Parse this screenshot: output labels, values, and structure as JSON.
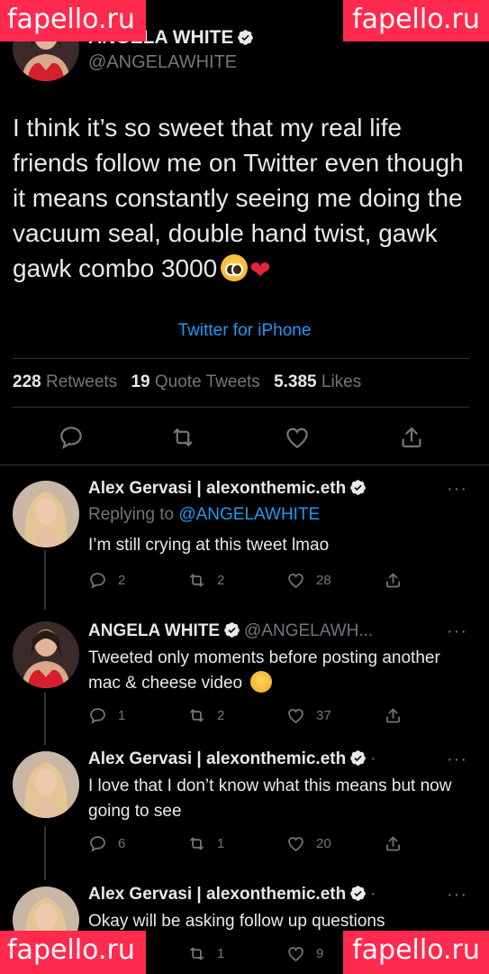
{
  "watermark": "fapello.ru",
  "main_tweet": {
    "name": "ANGELA WHITE",
    "name_visible": "ANGELA WHITE",
    "handle": "@ANGELAWHITE",
    "text": "I think it’s so sweet that my real life friends follow me on Twitter even though it means constantly seeing me doing the vacuum seal, double hand twist, gawk gawk combo 3000",
    "emojis": [
      "pleading-face-emoji",
      "red-heart-emoji"
    ],
    "source": "Twitter for iPhone",
    "stats": {
      "retweets_count": "228",
      "retweets_label": "Retweets",
      "quotes_count": "19",
      "quotes_label": "Quote Tweets",
      "likes_count": "5.385",
      "likes_label": "Likes"
    }
  },
  "replies": [
    {
      "name": "Alex Gervasi | alexonthemic.eth",
      "handle": "",
      "replying_prefix": "Replying to ",
      "replying_to": "@ANGELAWHITE",
      "text": "I’m still crying at this tweet lmao",
      "reply_count": "2",
      "retweet_count": "2",
      "like_count": "28"
    },
    {
      "name": "ANGELA WHITE",
      "handle": "@ANGELAWH...",
      "text": "Tweeted only moments before posting another mac & cheese video",
      "reply_count": "1",
      "retweet_count": "2",
      "like_count": "37"
    },
    {
      "name": "Alex Gervasi | alexonthemic.eth",
      "handle": "·",
      "text": "I love that I don’t know what this means but now going to see",
      "reply_count": "6",
      "retweet_count": "1",
      "like_count": "20"
    },
    {
      "name": "Alex Gervasi | alexonthemic.eth",
      "handle": "·",
      "text": "Okay will be asking follow up questions",
      "reply_count": "",
      "retweet_count": "1",
      "like_count": "9"
    }
  ],
  "more_label": "···",
  "colors": {
    "background": "#000000",
    "text": "#e7e9ea",
    "muted": "#71767b",
    "accent": "#1d9bf0",
    "watermark": "#ff2a4d",
    "heart": "#e0243a"
  }
}
